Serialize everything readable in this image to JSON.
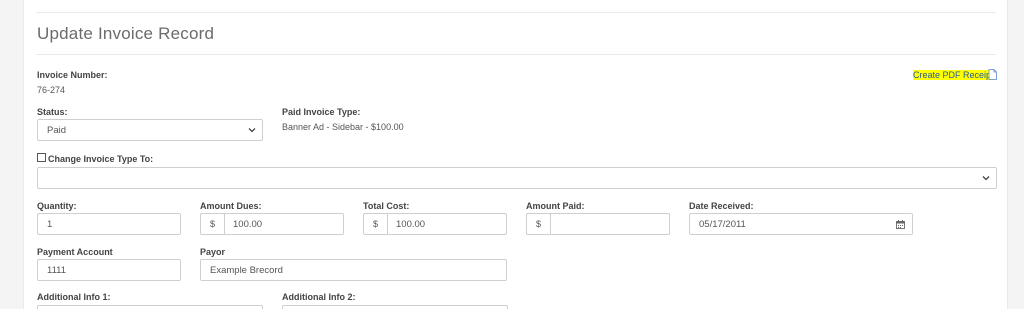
{
  "page": {
    "title": "Update Invoice Record"
  },
  "invoice": {
    "number_label": "Invoice Number:",
    "number_value": "76-274"
  },
  "pdf_link": {
    "label": "Create PDF Receipt"
  },
  "status": {
    "label": "Status:",
    "value": "Paid"
  },
  "paid_type": {
    "label": "Paid Invoice Type:",
    "value": "Banner Ad - Sidebar - $100.00"
  },
  "change_type": {
    "label": "Change Invoice Type To:",
    "value": ""
  },
  "quantity": {
    "label": "Quantity:",
    "value": "1"
  },
  "amount_dues": {
    "label": "Amount Dues:",
    "currency": "$",
    "value": "100.00"
  },
  "total_cost": {
    "label": "Total Cost:",
    "currency": "$",
    "value": "100.00"
  },
  "amount_paid": {
    "label": "Amount Paid:",
    "currency": "$",
    "value": ""
  },
  "date_received": {
    "label": "Date Received:",
    "value": "05/17/2011"
  },
  "payment_account": {
    "label": "Payment Account",
    "value": "1111"
  },
  "payor": {
    "label": "Payor",
    "value": "Example Brecord"
  },
  "additional_info_1": {
    "label": "Additional Info 1:"
  },
  "additional_info_2": {
    "label": "Additional Info 2:"
  },
  "colors": {
    "highlight": "#ffff00",
    "link": "#2a5a99"
  },
  "icons": {
    "pdf": "file-icon",
    "calendar": "calendar-icon",
    "select": "chevron-down-icon"
  }
}
